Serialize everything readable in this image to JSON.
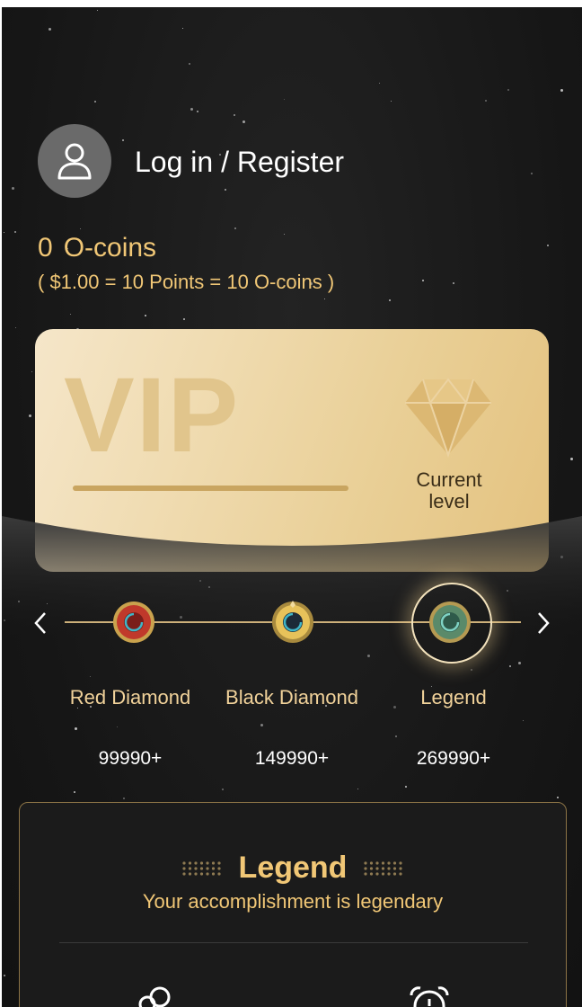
{
  "header": {
    "login_label": "Log in / Register"
  },
  "wallet": {
    "coins_value": "0",
    "coins_unit": "O-coins",
    "rate_text": "( $1.00 = 10 Points = 10 O-coins )"
  },
  "vip_card": {
    "watermark": "VIP",
    "current_level_label": "Current level",
    "progress": 0
  },
  "levels": [
    {
      "name": "Red Diamond",
      "points": "99990+"
    },
    {
      "name": "Black Diamond",
      "points": "149990+"
    },
    {
      "name": "Legend",
      "points": "269990+",
      "selected": true
    }
  ],
  "legend_panel": {
    "title": "Legend",
    "subtitle": "Your accomplishment is legendary",
    "perk_icons": [
      "coins-icon",
      "alarm-clock-icon"
    ]
  },
  "colors": {
    "accent_gold": "#f1c776",
    "background": "#161616",
    "card_gold": "#e9cf96"
  }
}
